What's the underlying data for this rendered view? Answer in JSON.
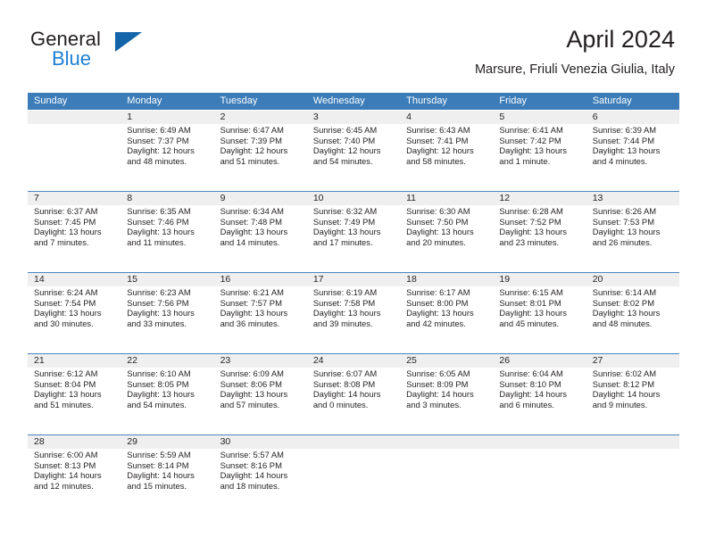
{
  "brand": {
    "name_part1": "General",
    "name_part2": "Blue",
    "accent_color": "#1b7fd4",
    "triangle_color": "#1464aa"
  },
  "header": {
    "month_title": "April 2024",
    "location": "Marsure, Friuli Venezia Giulia, Italy",
    "header_bg_color": "#3b7cb9",
    "date_band_color": "#efefef"
  },
  "weekdays": [
    "Sunday",
    "Monday",
    "Tuesday",
    "Wednesday",
    "Thursday",
    "Friday",
    "Saturday"
  ],
  "weeks": [
    {
      "days": [
        {
          "num": "",
          "sunrise": "",
          "sunset": "",
          "daylight_line1": "",
          "daylight_line2": "",
          "empty": true
        },
        {
          "num": "1",
          "sunrise": "Sunrise: 6:49 AM",
          "sunset": "Sunset: 7:37 PM",
          "daylight_line1": "Daylight: 12 hours",
          "daylight_line2": "and 48 minutes.",
          "empty": false
        },
        {
          "num": "2",
          "sunrise": "Sunrise: 6:47 AM",
          "sunset": "Sunset: 7:39 PM",
          "daylight_line1": "Daylight: 12 hours",
          "daylight_line2": "and 51 minutes.",
          "empty": false
        },
        {
          "num": "3",
          "sunrise": "Sunrise: 6:45 AM",
          "sunset": "Sunset: 7:40 PM",
          "daylight_line1": "Daylight: 12 hours",
          "daylight_line2": "and 54 minutes.",
          "empty": false
        },
        {
          "num": "4",
          "sunrise": "Sunrise: 6:43 AM",
          "sunset": "Sunset: 7:41 PM",
          "daylight_line1": "Daylight: 12 hours",
          "daylight_line2": "and 58 minutes.",
          "empty": false
        },
        {
          "num": "5",
          "sunrise": "Sunrise: 6:41 AM",
          "sunset": "Sunset: 7:42 PM",
          "daylight_line1": "Daylight: 13 hours",
          "daylight_line2": "and 1 minute.",
          "empty": false
        },
        {
          "num": "6",
          "sunrise": "Sunrise: 6:39 AM",
          "sunset": "Sunset: 7:44 PM",
          "daylight_line1": "Daylight: 13 hours",
          "daylight_line2": "and 4 minutes.",
          "empty": false
        }
      ]
    },
    {
      "days": [
        {
          "num": "7",
          "sunrise": "Sunrise: 6:37 AM",
          "sunset": "Sunset: 7:45 PM",
          "daylight_line1": "Daylight: 13 hours",
          "daylight_line2": "and 7 minutes.",
          "empty": false
        },
        {
          "num": "8",
          "sunrise": "Sunrise: 6:35 AM",
          "sunset": "Sunset: 7:46 PM",
          "daylight_line1": "Daylight: 13 hours",
          "daylight_line2": "and 11 minutes.",
          "empty": false
        },
        {
          "num": "9",
          "sunrise": "Sunrise: 6:34 AM",
          "sunset": "Sunset: 7:48 PM",
          "daylight_line1": "Daylight: 13 hours",
          "daylight_line2": "and 14 minutes.",
          "empty": false
        },
        {
          "num": "10",
          "sunrise": "Sunrise: 6:32 AM",
          "sunset": "Sunset: 7:49 PM",
          "daylight_line1": "Daylight: 13 hours",
          "daylight_line2": "and 17 minutes.",
          "empty": false
        },
        {
          "num": "11",
          "sunrise": "Sunrise: 6:30 AM",
          "sunset": "Sunset: 7:50 PM",
          "daylight_line1": "Daylight: 13 hours",
          "daylight_line2": "and 20 minutes.",
          "empty": false
        },
        {
          "num": "12",
          "sunrise": "Sunrise: 6:28 AM",
          "sunset": "Sunset: 7:52 PM",
          "daylight_line1": "Daylight: 13 hours",
          "daylight_line2": "and 23 minutes.",
          "empty": false
        },
        {
          "num": "13",
          "sunrise": "Sunrise: 6:26 AM",
          "sunset": "Sunset: 7:53 PM",
          "daylight_line1": "Daylight: 13 hours",
          "daylight_line2": "and 26 minutes.",
          "empty": false
        }
      ]
    },
    {
      "days": [
        {
          "num": "14",
          "sunrise": "Sunrise: 6:24 AM",
          "sunset": "Sunset: 7:54 PM",
          "daylight_line1": "Daylight: 13 hours",
          "daylight_line2": "and 30 minutes.",
          "empty": false
        },
        {
          "num": "15",
          "sunrise": "Sunrise: 6:23 AM",
          "sunset": "Sunset: 7:56 PM",
          "daylight_line1": "Daylight: 13 hours",
          "daylight_line2": "and 33 minutes.",
          "empty": false
        },
        {
          "num": "16",
          "sunrise": "Sunrise: 6:21 AM",
          "sunset": "Sunset: 7:57 PM",
          "daylight_line1": "Daylight: 13 hours",
          "daylight_line2": "and 36 minutes.",
          "empty": false
        },
        {
          "num": "17",
          "sunrise": "Sunrise: 6:19 AM",
          "sunset": "Sunset: 7:58 PM",
          "daylight_line1": "Daylight: 13 hours",
          "daylight_line2": "and 39 minutes.",
          "empty": false
        },
        {
          "num": "18",
          "sunrise": "Sunrise: 6:17 AM",
          "sunset": "Sunset: 8:00 PM",
          "daylight_line1": "Daylight: 13 hours",
          "daylight_line2": "and 42 minutes.",
          "empty": false
        },
        {
          "num": "19",
          "sunrise": "Sunrise: 6:15 AM",
          "sunset": "Sunset: 8:01 PM",
          "daylight_line1": "Daylight: 13 hours",
          "daylight_line2": "and 45 minutes.",
          "empty": false
        },
        {
          "num": "20",
          "sunrise": "Sunrise: 6:14 AM",
          "sunset": "Sunset: 8:02 PM",
          "daylight_line1": "Daylight: 13 hours",
          "daylight_line2": "and 48 minutes.",
          "empty": false
        }
      ]
    },
    {
      "days": [
        {
          "num": "21",
          "sunrise": "Sunrise: 6:12 AM",
          "sunset": "Sunset: 8:04 PM",
          "daylight_line1": "Daylight: 13 hours",
          "daylight_line2": "and 51 minutes.",
          "empty": false
        },
        {
          "num": "22",
          "sunrise": "Sunrise: 6:10 AM",
          "sunset": "Sunset: 8:05 PM",
          "daylight_line1": "Daylight: 13 hours",
          "daylight_line2": "and 54 minutes.",
          "empty": false
        },
        {
          "num": "23",
          "sunrise": "Sunrise: 6:09 AM",
          "sunset": "Sunset: 8:06 PM",
          "daylight_line1": "Daylight: 13 hours",
          "daylight_line2": "and 57 minutes.",
          "empty": false
        },
        {
          "num": "24",
          "sunrise": "Sunrise: 6:07 AM",
          "sunset": "Sunset: 8:08 PM",
          "daylight_line1": "Daylight: 14 hours",
          "daylight_line2": "and 0 minutes.",
          "empty": false
        },
        {
          "num": "25",
          "sunrise": "Sunrise: 6:05 AM",
          "sunset": "Sunset: 8:09 PM",
          "daylight_line1": "Daylight: 14 hours",
          "daylight_line2": "and 3 minutes.",
          "empty": false
        },
        {
          "num": "26",
          "sunrise": "Sunrise: 6:04 AM",
          "sunset": "Sunset: 8:10 PM",
          "daylight_line1": "Daylight: 14 hours",
          "daylight_line2": "and 6 minutes.",
          "empty": false
        },
        {
          "num": "27",
          "sunrise": "Sunrise: 6:02 AM",
          "sunset": "Sunset: 8:12 PM",
          "daylight_line1": "Daylight: 14 hours",
          "daylight_line2": "and 9 minutes.",
          "empty": false
        }
      ]
    },
    {
      "days": [
        {
          "num": "28",
          "sunrise": "Sunrise: 6:00 AM",
          "sunset": "Sunset: 8:13 PM",
          "daylight_line1": "Daylight: 14 hours",
          "daylight_line2": "and 12 minutes.",
          "empty": false
        },
        {
          "num": "29",
          "sunrise": "Sunrise: 5:59 AM",
          "sunset": "Sunset: 8:14 PM",
          "daylight_line1": "Daylight: 14 hours",
          "daylight_line2": "and 15 minutes.",
          "empty": false
        },
        {
          "num": "30",
          "sunrise": "Sunrise: 5:57 AM",
          "sunset": "Sunset: 8:16 PM",
          "daylight_line1": "Daylight: 14 hours",
          "daylight_line2": "and 18 minutes.",
          "empty": false
        },
        {
          "num": "",
          "sunrise": "",
          "sunset": "",
          "daylight_line1": "",
          "daylight_line2": "",
          "empty": true
        },
        {
          "num": "",
          "sunrise": "",
          "sunset": "",
          "daylight_line1": "",
          "daylight_line2": "",
          "empty": true
        },
        {
          "num": "",
          "sunrise": "",
          "sunset": "",
          "daylight_line1": "",
          "daylight_line2": "",
          "empty": true
        },
        {
          "num": "",
          "sunrise": "",
          "sunset": "",
          "daylight_line1": "",
          "daylight_line2": "",
          "empty": true
        }
      ]
    }
  ]
}
